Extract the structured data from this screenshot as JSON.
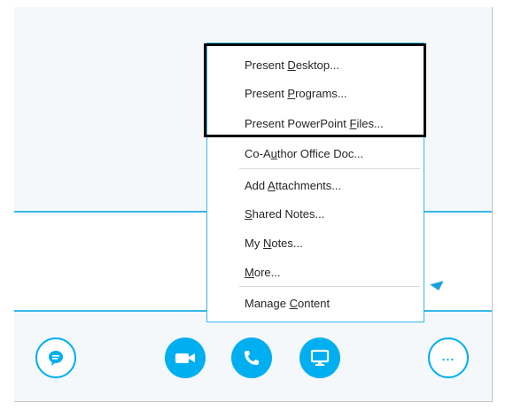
{
  "menu": {
    "items": [
      {
        "label_pre": "Present ",
        "label_u": "D",
        "label_post": "esktop..."
      },
      {
        "label_pre": "Present ",
        "label_u": "P",
        "label_post": "rograms..."
      },
      {
        "label_pre": "Present PowerPoint ",
        "label_u": "F",
        "label_post": "iles..."
      },
      {
        "label_pre": "Co-A",
        "label_u": "u",
        "label_post": "thor Office Doc..."
      },
      {
        "label_pre": "Add ",
        "label_u": "A",
        "label_post": "ttachments..."
      },
      {
        "label_pre": "",
        "label_u": "S",
        "label_post": "hared Notes..."
      },
      {
        "label_pre": "My ",
        "label_u": "N",
        "label_post": "otes..."
      },
      {
        "label_pre": "",
        "label_u": "M",
        "label_post": "ore..."
      },
      {
        "label_pre": "Manage ",
        "label_u": "C",
        "label_post": "ontent"
      }
    ]
  },
  "toolbar": {
    "buttons": [
      {
        "icon": "chat-bubble-icon"
      },
      {
        "icon": "video-camera-icon"
      },
      {
        "icon": "phone-icon"
      },
      {
        "icon": "monitor-icon"
      },
      {
        "icon": "more-ellipsis-icon"
      }
    ],
    "more_label": "..."
  },
  "colors": {
    "accent": "#00aff0",
    "line": "#36b7e7",
    "highlight_border": "#000000"
  }
}
